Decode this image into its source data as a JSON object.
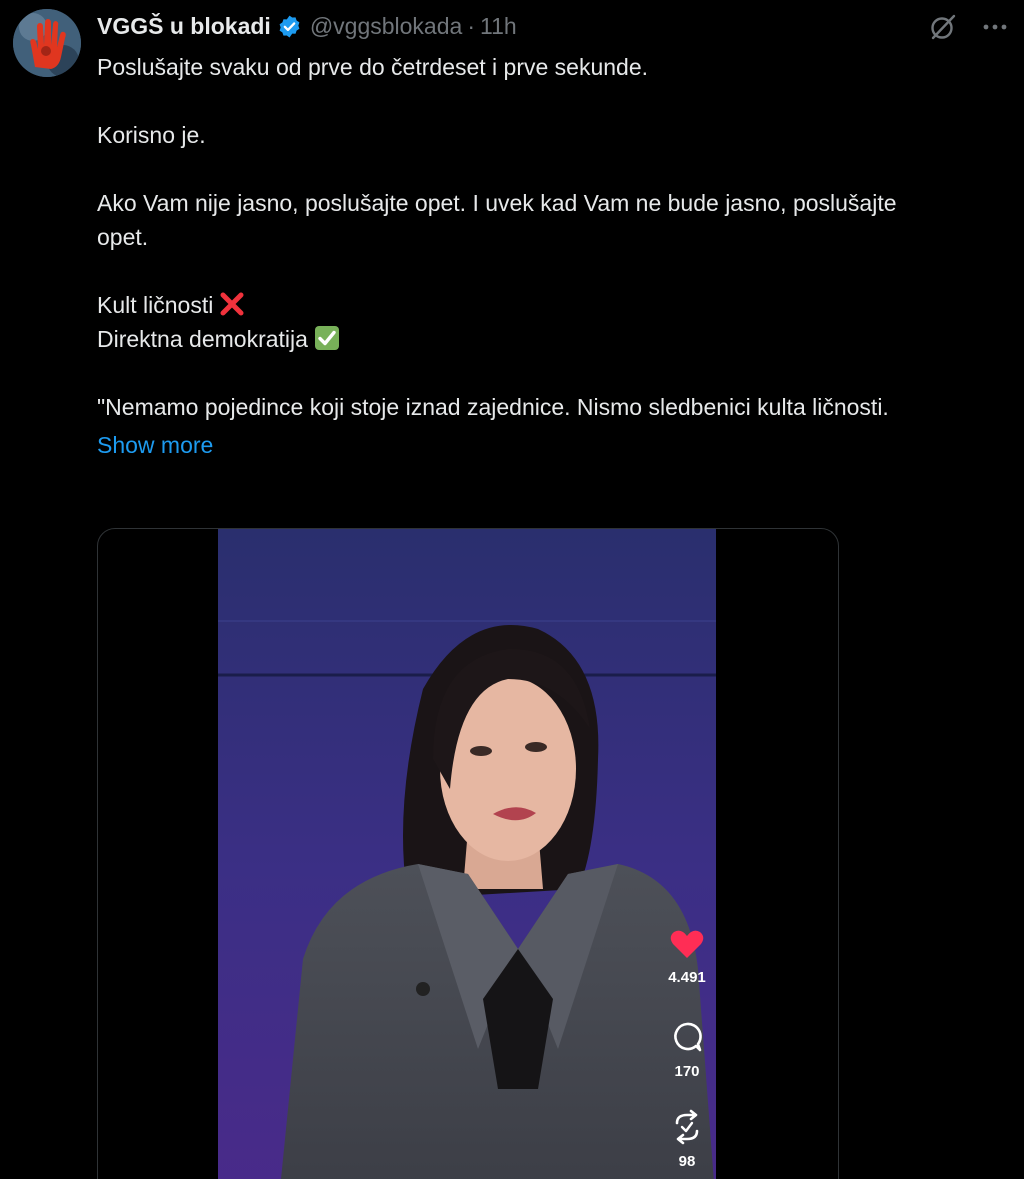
{
  "author": {
    "display_name": "VGGŠ u blokadi",
    "handle": "@vggsblokada",
    "separator": "·",
    "time": "11h",
    "verified_color": "#1d9bf0"
  },
  "header_icons": [
    "grok-icon",
    "more-icon"
  ],
  "tweet": {
    "lines": [
      "Poslušajte svaku od prve do četrdeset i prve sekunde.",
      "Korisno je.",
      "Ako Vam nije jasno, poslušajte opet. I uvek kad Vam ne bude jasno, poslušajte opet.",
      "Kult ličnosti",
      "Direktna demokratija",
      "\"Nemamo pojedince koji stoje iznad zajednice. Nismo sledbenici kulta ličnosti."
    ],
    "emoji": {
      "kult": "cross-mark-emoji",
      "demokratija": "check-mark-emoji"
    },
    "show_more": "Show more"
  },
  "video": {
    "likes": "4.491",
    "comments": "170",
    "reposts": "98",
    "like_color": "#ff2d55"
  },
  "colors": {
    "background": "#000000",
    "text": "#e7e9ea",
    "muted": "#71767b",
    "link": "#1d9bf0"
  }
}
